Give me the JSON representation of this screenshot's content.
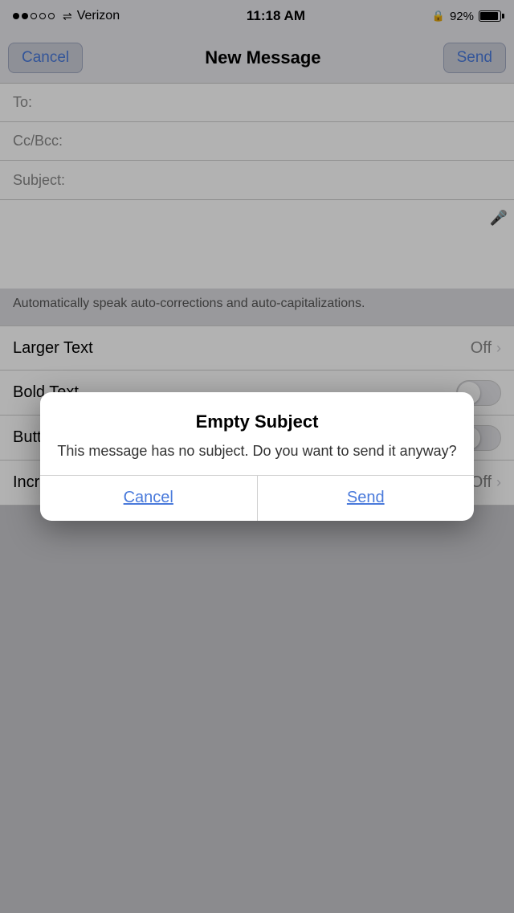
{
  "statusBar": {
    "carrier": "Verizon",
    "time": "11:18 AM",
    "battery": "92%",
    "signalDots": 2,
    "totalDots": 5
  },
  "navBar": {
    "cancelLabel": "Cancel",
    "title": "New Message",
    "sendLabel": "Send"
  },
  "composeFields": {
    "toLabel": "To:",
    "ccBccLabel": "Cc/Bcc:",
    "subjectLabel": "Subject:"
  },
  "settings": {
    "descriptionText": "Automatically speak auto-corrections and auto-capitalizations.",
    "rows": [
      {
        "label": "Larger Text",
        "value": "Off",
        "type": "chevron"
      },
      {
        "label": "Bold Text",
        "value": "",
        "type": "toggle"
      },
      {
        "label": "Button Shapes",
        "value": "",
        "type": "toggle"
      },
      {
        "label": "Increase Contrast",
        "value": "Off",
        "type": "chevron"
      }
    ]
  },
  "modal": {
    "title": "Empty Subject",
    "message": "This message has no subject. Do you want to send it anyway?",
    "cancelLabel": "Cancel",
    "sendLabel": "Send"
  }
}
